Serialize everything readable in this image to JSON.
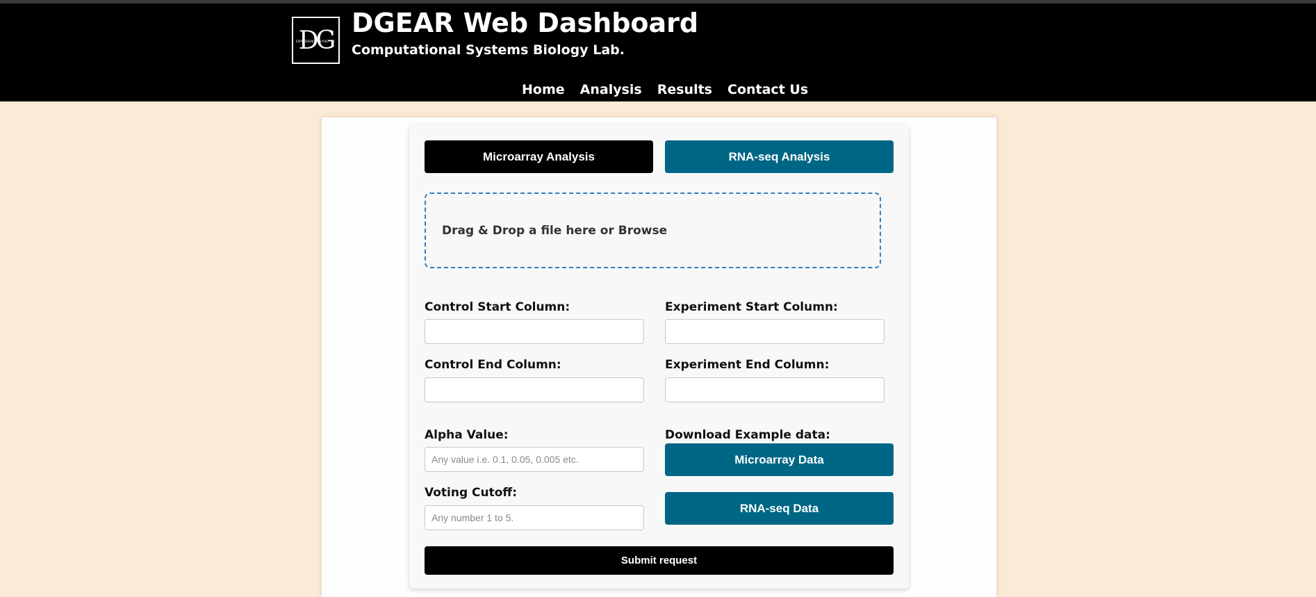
{
  "header": {
    "logo_text": "DG",
    "logo_small_text": "EXPRESSION ANALYSIS",
    "title": "DGEAR Web Dashboard",
    "subtitle": "Computational Systems Biology Lab."
  },
  "nav": {
    "items": [
      {
        "label": "Home"
      },
      {
        "label": "Analysis"
      },
      {
        "label": "Results"
      },
      {
        "label": "Contact Us"
      }
    ]
  },
  "tabs": {
    "microarray": "Microarray Analysis",
    "rnaseq": "RNA-seq Analysis"
  },
  "dropzone": {
    "text": "Drag & Drop a file here or Browse"
  },
  "form": {
    "control_start_label": "Control Start Column:",
    "control_start_value": "",
    "experiment_start_label": "Experiment Start Column:",
    "experiment_start_value": "",
    "control_end_label": "Control End Column:",
    "control_end_value": "",
    "experiment_end_label": "Experiment End Column:",
    "experiment_end_value": "",
    "alpha_label": "Alpha Value:",
    "alpha_placeholder": "Any value i.e. 0.1, 0.05, 0.005 etc.",
    "voting_label": "Voting Cutoff:",
    "voting_placeholder": "Any number 1 to 5."
  },
  "download": {
    "label": "Download Example data:",
    "microarray_button": "Microarray Data",
    "rnaseq_button": "RNA-seq Data"
  },
  "submit": {
    "label": "Submit request"
  },
  "colors": {
    "header_bg": "#000000",
    "page_bg": "#fbead6",
    "accent": "#006685",
    "dropzone_border": "#2f7fc3"
  }
}
